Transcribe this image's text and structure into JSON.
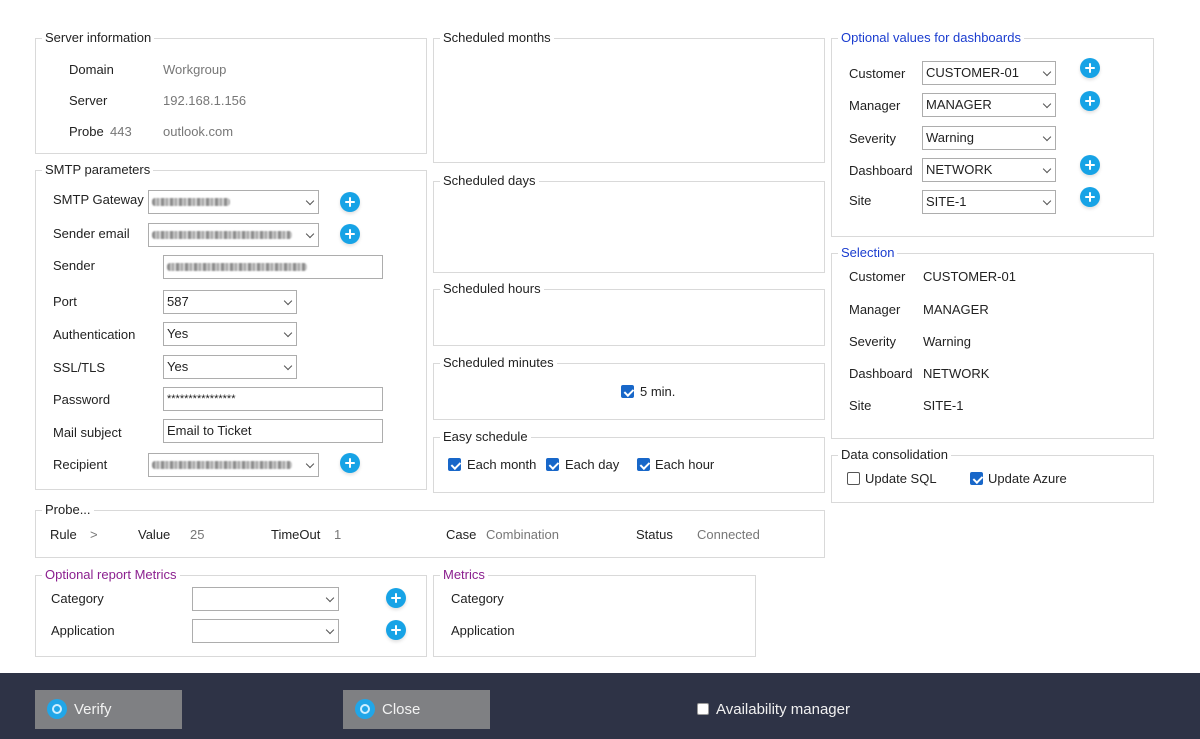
{
  "server_info": {
    "title": "Server information",
    "domain_label": "Domain",
    "domain_value": "Workgroup",
    "server_label": "Server",
    "server_value": "192.168.1.156",
    "probe_label": "Probe",
    "probe_port": "443",
    "probe_value": "outlook.com"
  },
  "smtp": {
    "title": "SMTP parameters",
    "gateway_label": "SMTP Gateway",
    "sender_email_label": "Sender email",
    "sender_label": "Sender",
    "port_label": "Port",
    "port_value": "587",
    "auth_label": "Authentication",
    "auth_value": "Yes",
    "ssl_label": "SSL/TLS",
    "ssl_value": "Yes",
    "password_label": "Password",
    "password_value": "****************",
    "subject_label": "Mail subject",
    "subject_value": "Email to Ticket",
    "recipient_label": "Recipient"
  },
  "schedule": {
    "months_title": "Scheduled months",
    "days_title": "Scheduled days",
    "hours_title": "Scheduled hours",
    "minutes_title": "Scheduled minutes",
    "minutes_option": "5 min.",
    "easy_title": "Easy schedule",
    "each_month": "Each month",
    "each_day": "Each day",
    "each_hour": "Each hour"
  },
  "optional_dash": {
    "title": "Optional values for dashboards",
    "customer_label": "Customer",
    "customer_value": "CUSTOMER-01",
    "manager_label": "Manager",
    "manager_value": "MANAGER",
    "severity_label": "Severity",
    "severity_value": "Warning",
    "dashboard_label": "Dashboard",
    "dashboard_value": "NETWORK",
    "site_label": "Site",
    "site_value": "SITE-1"
  },
  "selection": {
    "title": "Selection",
    "customer_label": "Customer",
    "customer_value": "CUSTOMER-01",
    "manager_label": "Manager",
    "manager_value": "MANAGER",
    "severity_label": "Severity",
    "severity_value": "Warning",
    "dashboard_label": "Dashboard",
    "dashboard_value": "NETWORK",
    "site_label": "Site",
    "site_value": "SITE-1"
  },
  "consolidation": {
    "title": "Data consolidation",
    "update_sql": "Update SQL",
    "update_sql_checked": false,
    "update_azure": "Update Azure",
    "update_azure_checked": true
  },
  "probe": {
    "title": "Probe...",
    "rule_label": "Rule",
    "rule_value": ">",
    "value_label": "Value",
    "value_value": "25",
    "timeout_label": "TimeOut",
    "timeout_value": "1",
    "case_label": "Case",
    "case_value": "Combination",
    "status_label": "Status",
    "status_value": "Connected"
  },
  "report_metrics": {
    "title": "Optional report Metrics",
    "category_label": "Category",
    "application_label": "Application"
  },
  "metrics": {
    "title": "Metrics",
    "category_label": "Category",
    "application_label": "Application"
  },
  "footer": {
    "verify_label": "Verify",
    "close_label": "Close",
    "availability_label": "Availability manager",
    "availability_checked": false
  },
  "colors": {
    "footer_bg": "#2e3346",
    "button_bg": "#7f8083",
    "accent_blue": "#17a3e6",
    "checkbox_blue": "#1867c9",
    "legend_blue": "#1a3ccf",
    "legend_purple": "#8b1f8f"
  }
}
